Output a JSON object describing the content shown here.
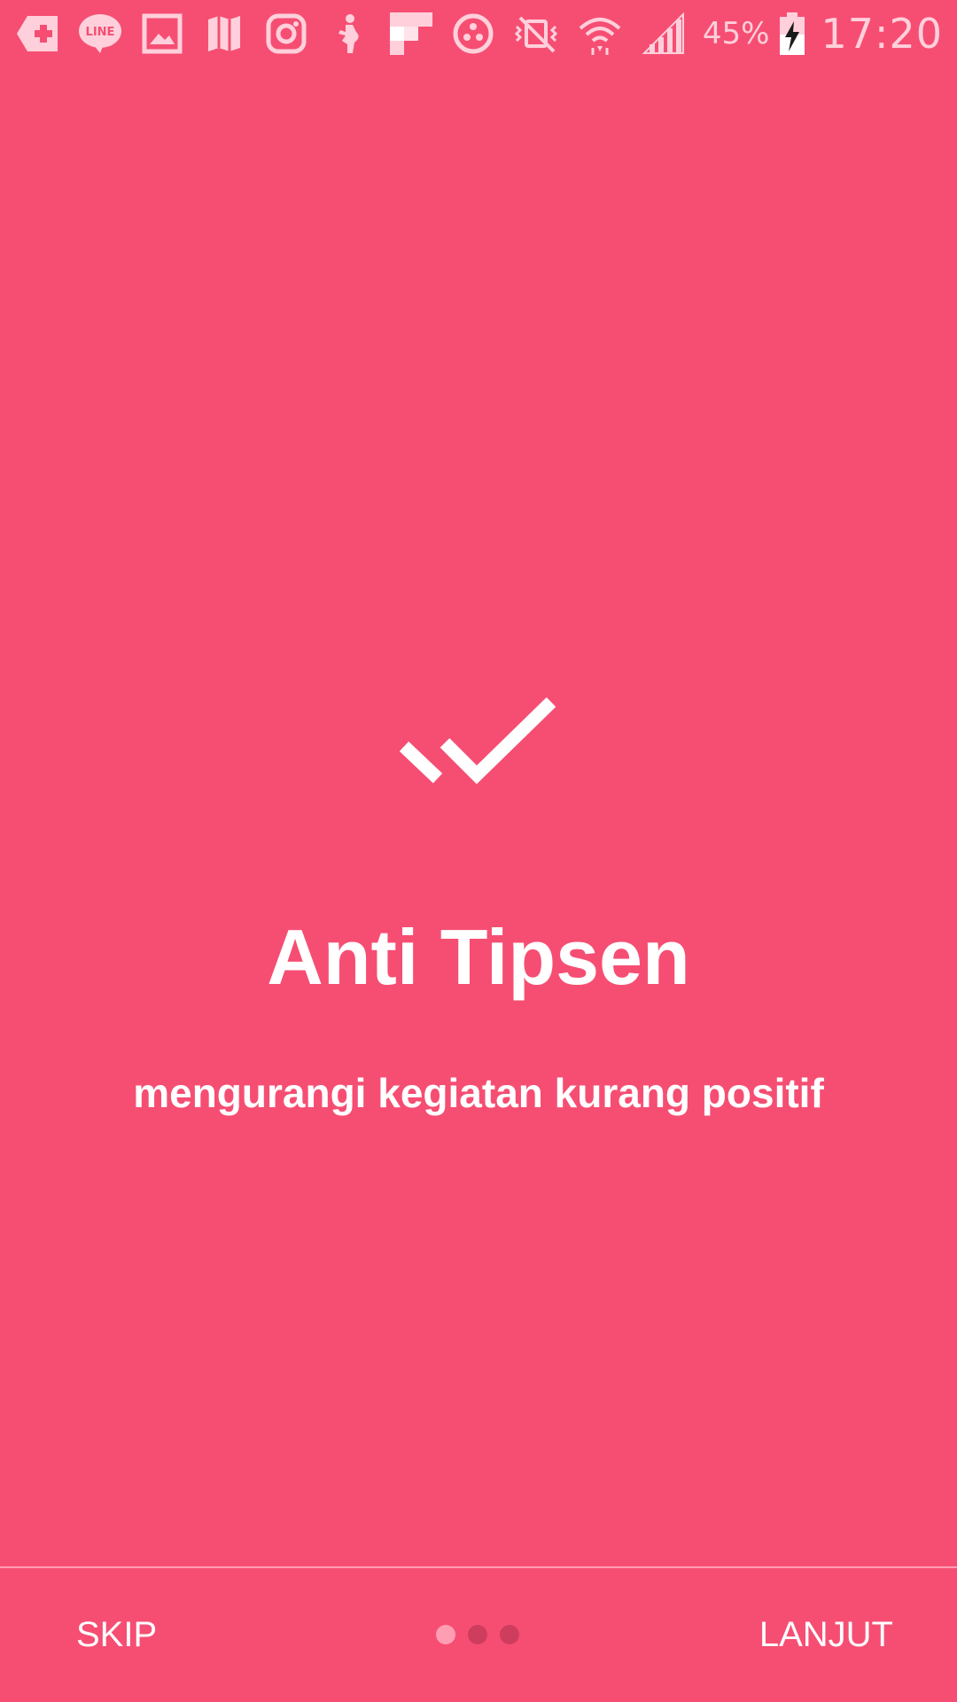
{
  "status_bar": {
    "notification_icons": [
      "medical-app-icon",
      "line-app-icon",
      "gallery-icon",
      "map-icon",
      "instagram-icon",
      "pregnancy-app-icon",
      "flipboard-icon",
      "bowling-app-icon"
    ],
    "system_icons": [
      "vibrate-off-icon",
      "wifi-icon",
      "signal-icon"
    ],
    "battery_percent": "45%",
    "time": "17:20"
  },
  "onboarding": {
    "icon": "double-check-icon",
    "title": "Anti Tipsen",
    "subtitle": "mengurangi kegiatan kurang positif"
  },
  "navigation": {
    "skip_label": "SKIP",
    "next_label": "LANJUT",
    "page_count": 3,
    "current_page": 1
  },
  "colors": {
    "background": "#f64e73",
    "text": "#ffffff",
    "dot_active": "#ff9db3",
    "dot_inactive": "#cf3d5e"
  }
}
